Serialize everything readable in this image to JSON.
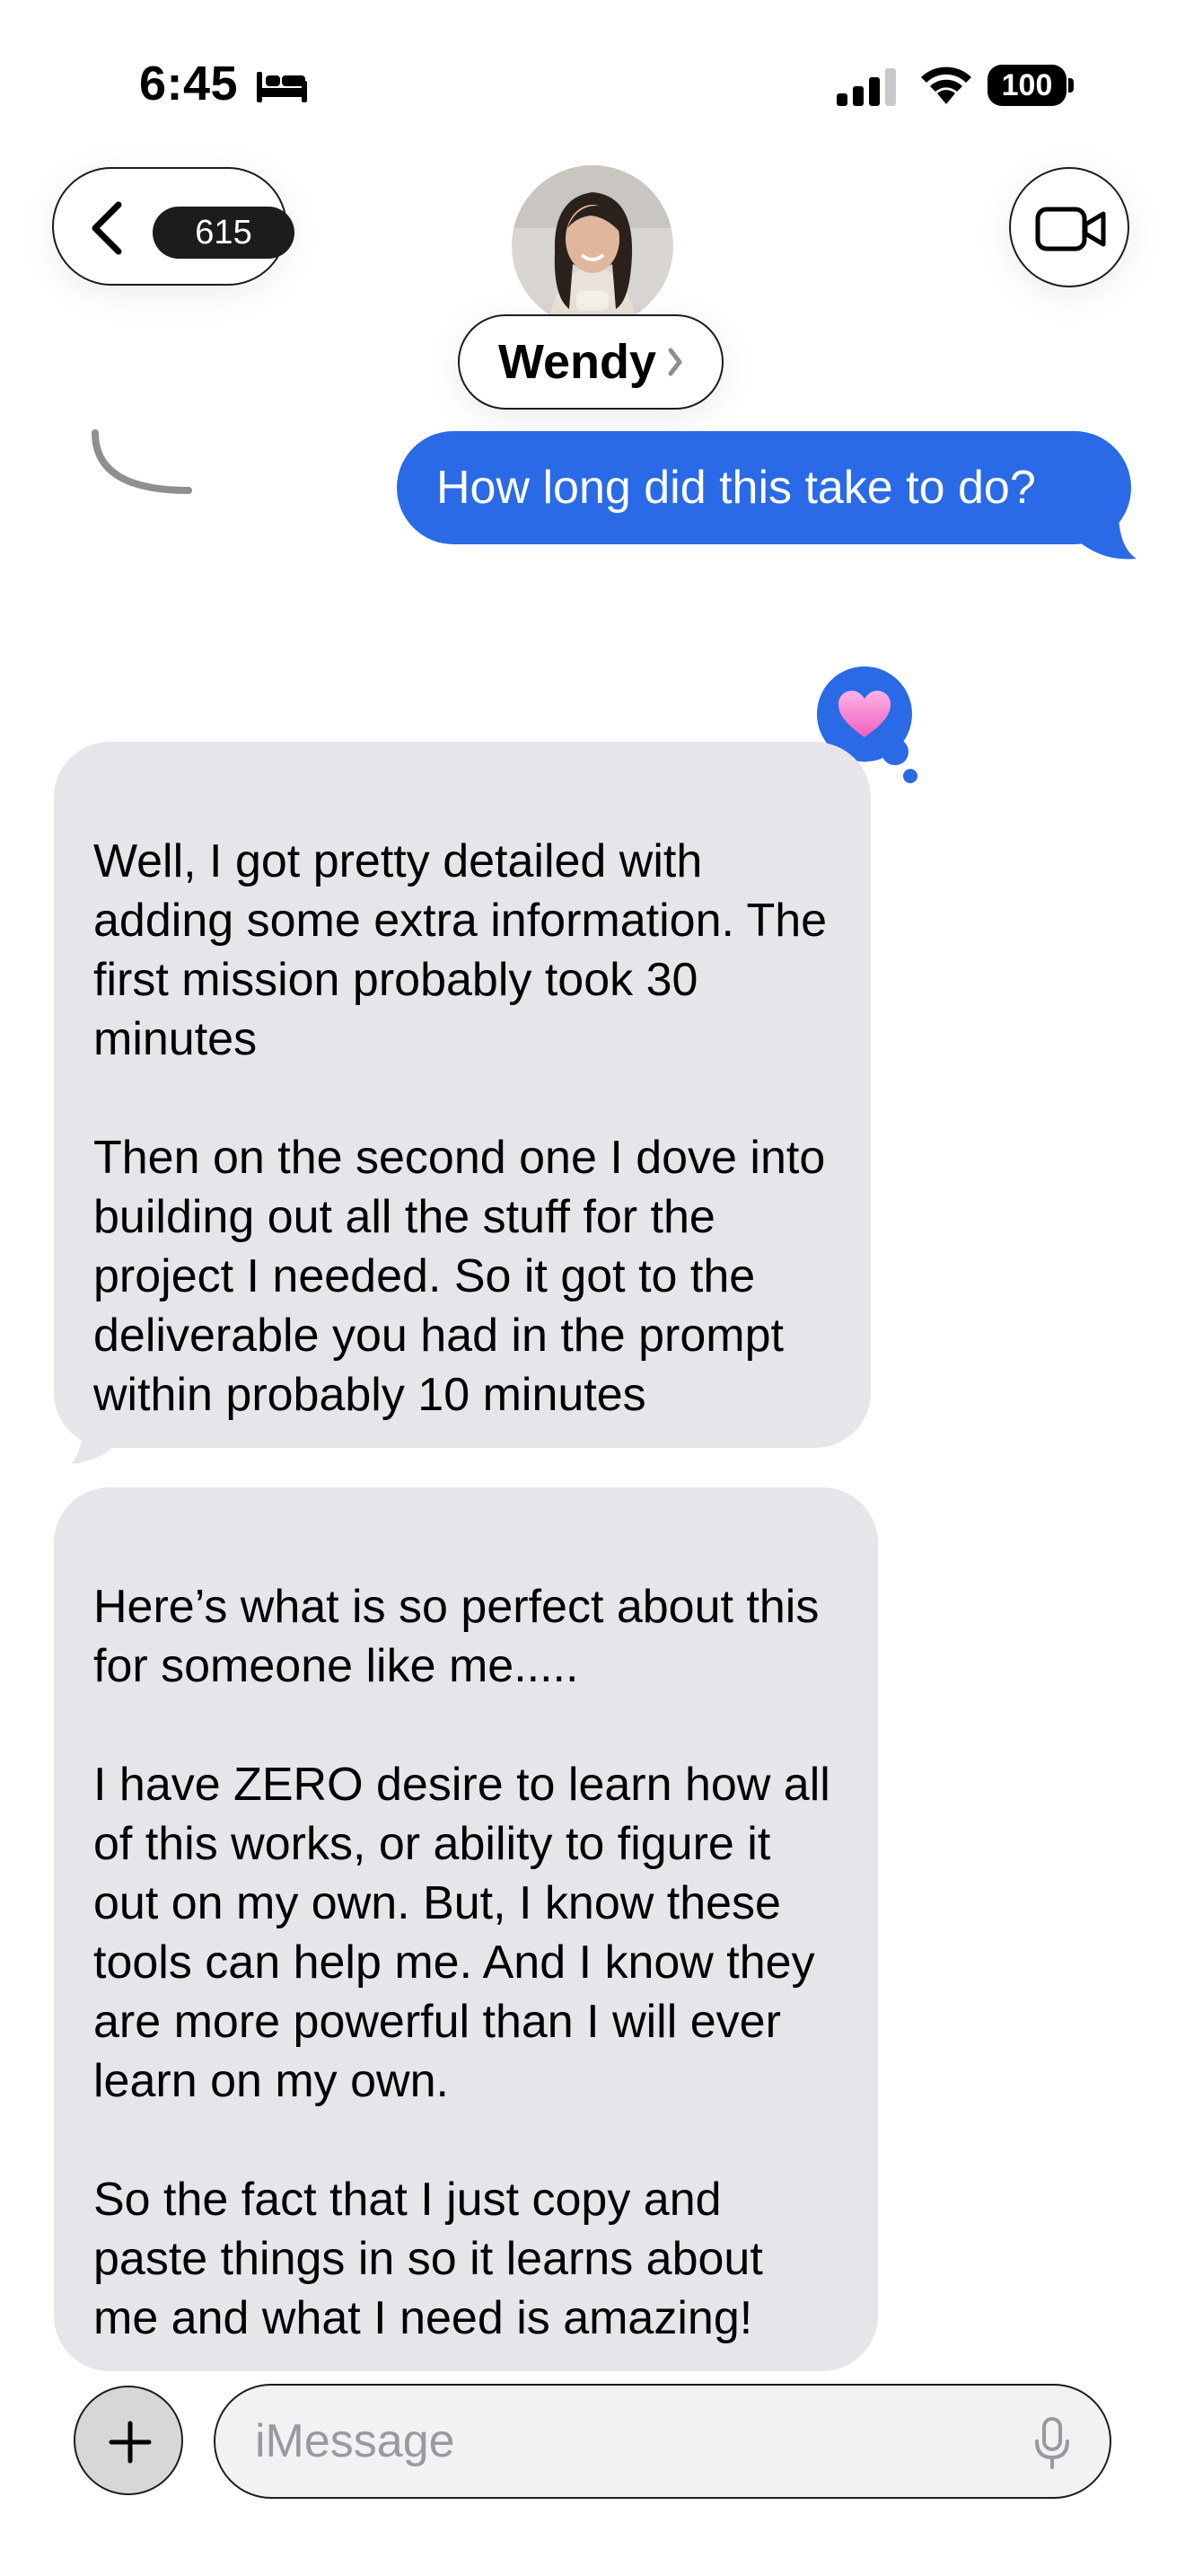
{
  "status_bar": {
    "time": "6:45",
    "battery": "100",
    "icons": [
      "bed-icon",
      "signal-icon",
      "wifi-icon",
      "battery-icon"
    ]
  },
  "header": {
    "unread_count": "615",
    "contact_name": "Wendy",
    "icons": [
      "chevron-left-icon",
      "video-camera-icon",
      "chevron-right-icon"
    ]
  },
  "messages": [
    {
      "direction": "sent",
      "text": "How long did this take to do?",
      "reaction": "heart"
    },
    {
      "direction": "received",
      "text": "Well, I got pretty detailed with adding some extra information. The first mission probably took 30 minutes\n\nThen on the second one I dove into building out all the stuff for the project I needed. So it got to the deliverable you had in the prompt within probably 10 minutes"
    },
    {
      "direction": "received",
      "text": "Here’s what is so perfect about this for someone like me.....\n\nI have ZERO desire to learn how all of this works, or ability to figure it out on my own. But, I know these tools can help me. And I know they are more powerful than I will ever learn on my own.\n\nSo the fact that I just copy and paste things in so it learns about me and what I need is amazing!"
    }
  ],
  "composer": {
    "placeholder": "iMessage",
    "icons": [
      "plus-icon",
      "microphone-icon"
    ]
  },
  "colors": {
    "sent_bubble": "#2a6ae6",
    "received_bubble": "#e5e5ea",
    "tapback_heart": "#f472c8"
  }
}
